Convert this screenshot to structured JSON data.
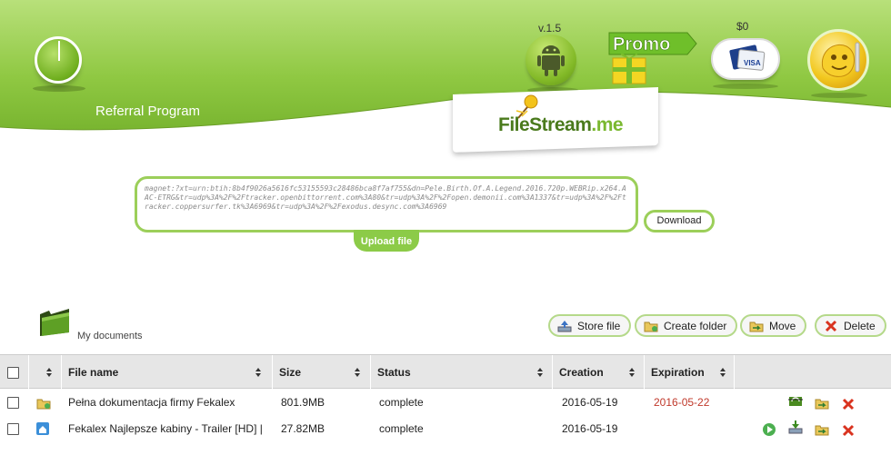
{
  "header": {
    "referral_label": "Referral Program",
    "version": "v.1.5",
    "promo_label": "Promo",
    "balance": "$0",
    "logo_text_1": "FileStream",
    "logo_text_2": ".me"
  },
  "magnet": {
    "value": "magnet:?xt=urn:btih:8b4f9026a5616fc53155593c28486bca8f7af755&dn=Pele.Birth.Of.A.Legend.2016.720p.WEBRip.x264.AAC-ETRG&tr=udp%3A%2F%2Ftracker.openbittorrent.com%3A80&tr=udp%3A%2F%2Fopen.demonii.com%3A1337&tr=udp%3A%2F%2Ftracker.coppersurfer.tk%3A6969&tr=udp%3A%2F%2Fexodus.desync.com%3A6969",
    "upload_label": "Upload file",
    "download_label": "Download"
  },
  "documents": {
    "title": "My documents",
    "actions": {
      "store": "Store file",
      "create_folder": "Create folder",
      "move": "Move",
      "delete": "Delete"
    }
  },
  "table": {
    "headers": {
      "name": "File name",
      "size": "Size",
      "status": "Status",
      "creation": "Creation",
      "expiration": "Expiration"
    },
    "rows": [
      {
        "name": "Pełna dokumentacja firmy Fekalex",
        "size": "801.9MB",
        "status": "complete",
        "creation": "2016-05-19",
        "expiration": "2016-05-22"
      },
      {
        "name": "Fekalex Najlepsze kabiny - Trailer [HD] |",
        "size": "27.82MB",
        "status": "complete",
        "creation": "2016-05-19",
        "expiration": ""
      }
    ]
  },
  "colors": {
    "header_green": "#8fc842",
    "accent_green": "#9ccf5a",
    "expiration_red": "#c0392b"
  }
}
